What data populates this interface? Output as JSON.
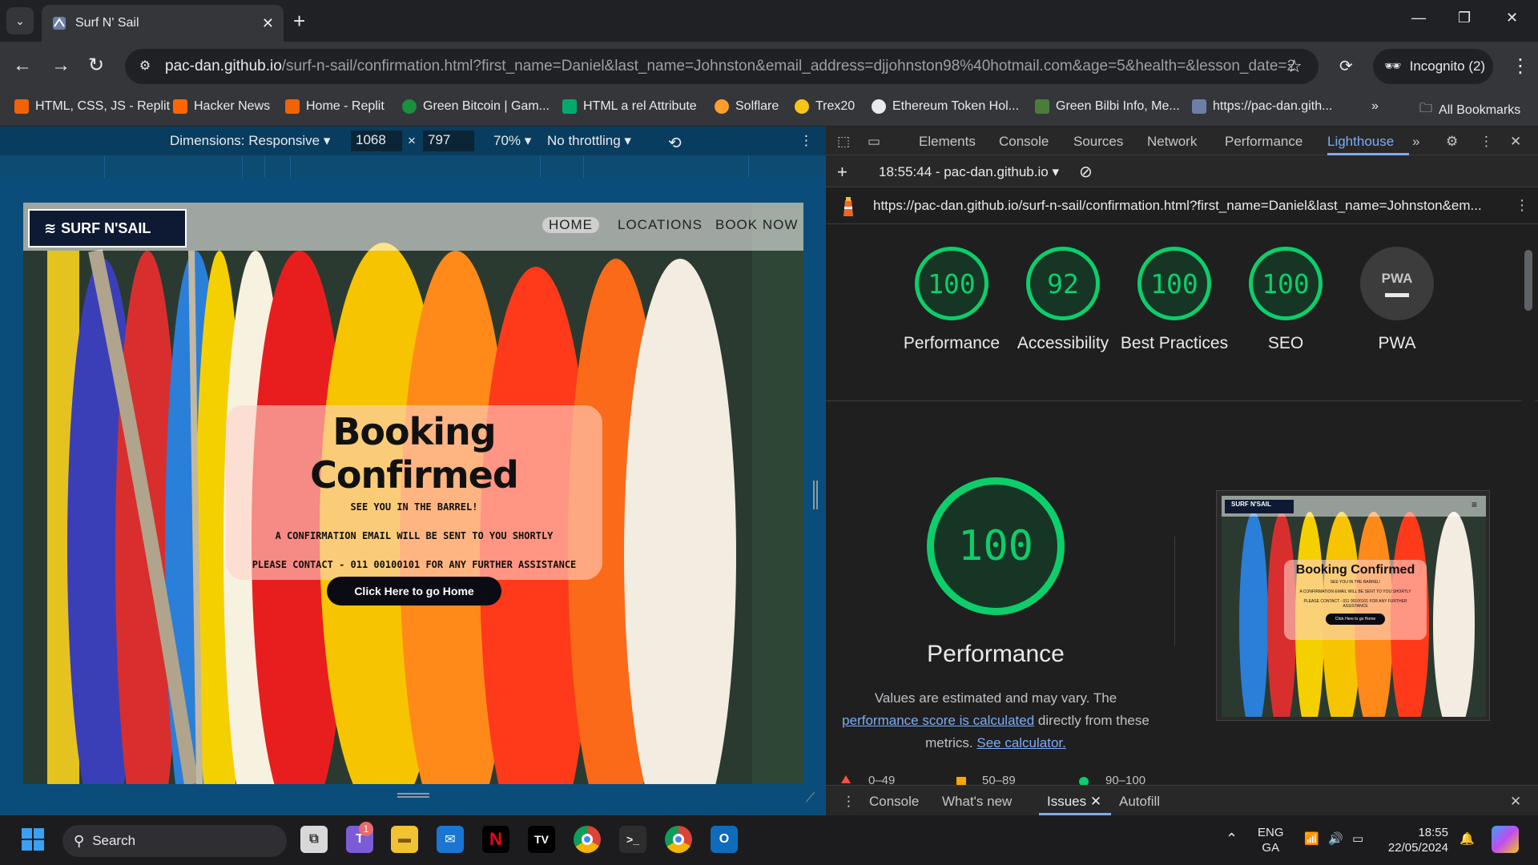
{
  "browser": {
    "tab_title": "Surf N' Sail",
    "url_host": "pac-dan.github.io",
    "url_rest": "/surf-n-sail/confirmation.html?first_name=Daniel&last_name=Johnston&email_address=djjohnston98%40hotmail.com&age=5&health=&lesson_date=20...",
    "incognito_label": "Incognito (2)"
  },
  "bookmarks": [
    {
      "label": "HTML, CSS, JS - Replit",
      "icon": "replit-icon",
      "color": "#f26207"
    },
    {
      "label": "Hacker News",
      "icon": "hacker-news-icon",
      "color": "#ff6600"
    },
    {
      "label": "Home - Replit",
      "icon": "replit-icon",
      "color": "#f26207"
    },
    {
      "label": "Green Bitcoin | Gam...",
      "icon": "green-bitcoin-icon",
      "color": "#1a8f3c"
    },
    {
      "label": "HTML a rel Attribute",
      "icon": "w3schools-icon",
      "color": "#04aa6d"
    },
    {
      "label": "Solflare",
      "icon": "solflare-icon",
      "color": "#fc9d2c"
    },
    {
      "label": "Trex20",
      "icon": "trex20-icon",
      "color": "#f5c518"
    },
    {
      "label": "Ethereum Token Hol...",
      "icon": "etherscan-icon",
      "color": "#e8eaed"
    },
    {
      "label": "Green Bilbi Info, Me...",
      "icon": "green-bilbi-icon",
      "color": "#4a7d3a"
    },
    {
      "label": "https://pac-dan.gith...",
      "icon": "site-icon",
      "color": "#6d7fa8"
    }
  ],
  "all_bookmarks_label": "All Bookmarks",
  "device_toolbar": {
    "dimensions_label": "Dimensions: Responsive",
    "width": "1068",
    "times": "×",
    "height": "797",
    "zoom": "70%",
    "throttling": "No throttling"
  },
  "site": {
    "logo_text": "SURF N'SAIL",
    "nav": [
      "HOME",
      "LOCATIONS",
      "BOOK NOW"
    ],
    "heading": "Booking Confirmed",
    "line1": "SEE YOU IN THE BARREL!",
    "line2": "A CONFIRMATION EMAIL WILL BE SENT TO YOU SHORTLY",
    "line3": "PLEASE CONTACT - 011 00100101 FOR ANY FURTHER ASSISTANCE",
    "button": "Click Here to go Home"
  },
  "devtools": {
    "tabs": [
      "Elements",
      "Console",
      "Sources",
      "Network",
      "Performance",
      "Lighthouse"
    ],
    "report_time": "18:55:44 - pac-dan.github.io",
    "report_url": "https://pac-dan.github.io/surf-n-sail/confirmation.html?first_name=Daniel&last_name=Johnston&em...",
    "scores": [
      {
        "score": "100",
        "label": "Performance"
      },
      {
        "score": "92",
        "label": "Accessibility"
      },
      {
        "score": "100",
        "label": "Best Practices"
      },
      {
        "score": "100",
        "label": "SEO"
      }
    ],
    "pwa_label": "PWA",
    "main_score": "100",
    "main_label": "Performance",
    "desc_prefix": "Values are estimated and may vary. The",
    "desc_link1": "performance score is calculated",
    "desc_mid": "directly from these metrics.",
    "desc_link2": "See calculator.",
    "legend": [
      "0–49",
      "50–89",
      "90–100"
    ],
    "drawer_tabs": [
      "Console",
      "What's new",
      "Issues",
      "Autofill"
    ]
  },
  "thumbnail": {
    "logo": "SURF N'SAIL",
    "heading": "Booking Confirmed",
    "line1": "SEE YOU IN THE BARREL!",
    "line2": "A CONFIRMATION EMAIL WILL BE SENT TO YOU SHORTLY",
    "line3": "PLEASE CONTACT - 011 00100101 FOR ANY FURTHER ASSISTANCE",
    "button": "Click Here to go Home"
  },
  "taskbar": {
    "search_label": "Search",
    "lang_top": "ENG",
    "lang_bottom": "GA",
    "time": "18:55",
    "date": "22/05/2024",
    "badge": "1"
  },
  "colors": {
    "score_green": "#0cce6b",
    "devtools_accent": "#7cacf8",
    "device_toolbar_bg": "#093d5f"
  }
}
